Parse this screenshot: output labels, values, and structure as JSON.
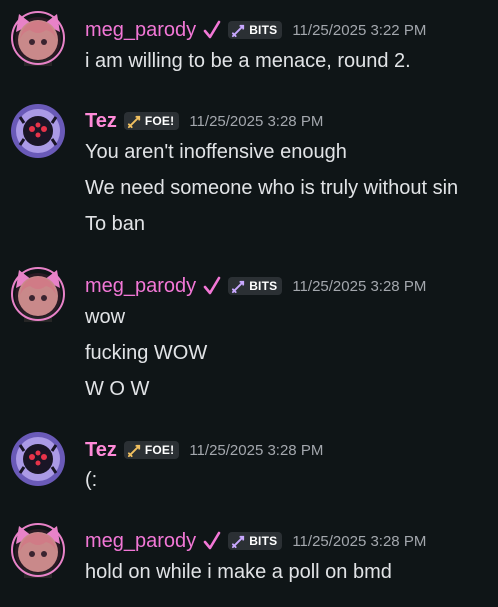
{
  "messages": [
    {
      "user": "meg_parody",
      "tag": "BITS",
      "timestamp": "11/25/2025 3:22 PM",
      "lines": [
        "i am willing to be a menace, round 2."
      ]
    },
    {
      "user": "Tez",
      "tag": "FOE!",
      "timestamp": "11/25/2025 3:28 PM",
      "lines": [
        "You aren't inoffensive enough",
        "We need someone who is truly without sin",
        "To ban"
      ]
    },
    {
      "user": "meg_parody",
      "tag": "BITS",
      "timestamp": "11/25/2025 3:28 PM",
      "lines": [
        "wow",
        "fucking WOW",
        "W O W"
      ]
    },
    {
      "user": "Tez",
      "tag": "FOE!",
      "timestamp": "11/25/2025 3:28 PM",
      "lines": [
        "(:"
      ]
    },
    {
      "user": "meg_parody",
      "tag": "BITS",
      "timestamp": "11/25/2025 3:28 PM",
      "lines": [
        "hold on while i make a poll on bmd"
      ]
    }
  ],
  "icons": {
    "verified": "checkmark-icon",
    "tag": "sword-icon",
    "meg_avatar": "avatar-meg",
    "tez_avatar": "avatar-tez"
  },
  "colors": {
    "background": "#0f1517",
    "meg_name": "#f277d6",
    "tez_name": "#ff8ad8",
    "tag_bg": "#2b3034",
    "timestamp": "#a3a7ad",
    "text": "#e1e3e6"
  }
}
